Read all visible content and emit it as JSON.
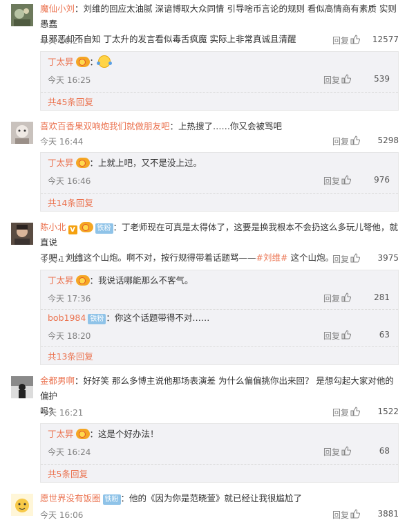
{
  "reply_label": "回复",
  "comments": [
    {
      "user": "魔仙小刘",
      "text": "：刘维的回应太油腻 深谙博取大众同情 引导啥币言论的规则 看似高情商有素质 实则愚蠢",
      "text2": "且邪恶却不自知 丁太升的发言看似毒舌疯魔 实际上非常真诚且清醒",
      "time": "今天 16:24",
      "likes": "12577",
      "replies": [
        {
          "user": "丁太昇",
          "text": "：",
          "time": "今天 16:25",
          "likes": "539"
        }
      ],
      "more": "共45条回复"
    },
    {
      "user": "喜欢百香果双响炮我们就做朋友吧",
      "text": "：上热搜了……你又会被骂吧",
      "time": "今天 16:44",
      "likes": "5298",
      "replies": [
        {
          "user": "丁太昇",
          "text": "：上就上吧，又不是没上过。",
          "time": "今天 16:46",
          "likes": "976"
        }
      ],
      "more": "共14条回复"
    },
    {
      "user": "陈小北",
      "fan_badge": "铁粉",
      "text": "：丁老师现在可真是太得体了，这要是换我根本不会扔这么多玩儿弩他，就直说",
      "text2a": "了吧，刘维这个山炮。啊不对，按行规得带着话题骂——",
      "hashtag": "#刘维#",
      "text2b": " 这个山炮。",
      "time": "今天 17:13",
      "likes": "3975",
      "replies": [
        {
          "user": "丁太昇",
          "text": "：我说话哪能那么不客气。",
          "time": "今天 17:36",
          "likes": "281"
        },
        {
          "user": "bob1984",
          "fan_badge": "铁粉",
          "text": "：你这个话题带得不对……",
          "time": "今天 18:20",
          "likes": "63"
        }
      ],
      "more": "共13条回复"
    },
    {
      "user": "金都男啊",
      "text": "：好好笑 那么多博主说他那场表演差 为什么偏偏挑你出来回？ 是想勾起大家对他的偏护",
      "text2": "吗？",
      "time": "今天 16:21",
      "likes": "1522",
      "replies": [
        {
          "user": "丁太昇",
          "text": "：这是个好办法！",
          "time": "今天 16:24",
          "likes": "68"
        }
      ],
      "more": "共5条回复"
    },
    {
      "user": "愿世界没有饭圈",
      "fan_badge": "铁粉",
      "text": "：他的《因为你是范晓萱》就已经让我很尴尬了",
      "time": "今天 16:06",
      "likes": "3881"
    }
  ]
}
